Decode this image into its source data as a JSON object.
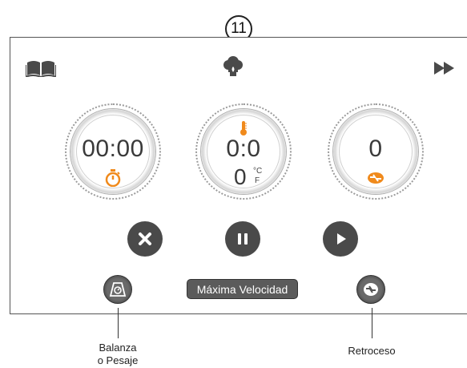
{
  "step_number": "11",
  "icons": {
    "recipe_book": "book-icon",
    "chef": "chef-hat-icon",
    "next": "fast-forward-icon",
    "timer": "stopwatch-icon",
    "thermometer": "thermometer-icon",
    "reverse": "reverse-rotation-icon",
    "cancel": "close-icon",
    "pause": "pause-icon",
    "play": "play-icon",
    "scale": "scale-icon"
  },
  "dials": {
    "timer": {
      "value": "00:00"
    },
    "temperature": {
      "value": "0:0",
      "temp": "0",
      "unit_c": "°C",
      "unit_f": "F"
    },
    "speed": {
      "value": "0"
    }
  },
  "buttons": {
    "max_speed_label": "Máxima Velocidad"
  },
  "callouts": {
    "scale_line1": "Balanza",
    "scale_line2": "o Pesaje",
    "reverse": "Retroceso"
  },
  "colors": {
    "accent": "#f08a1c",
    "control_bg": "#4a4a4a",
    "border": "#555555"
  }
}
